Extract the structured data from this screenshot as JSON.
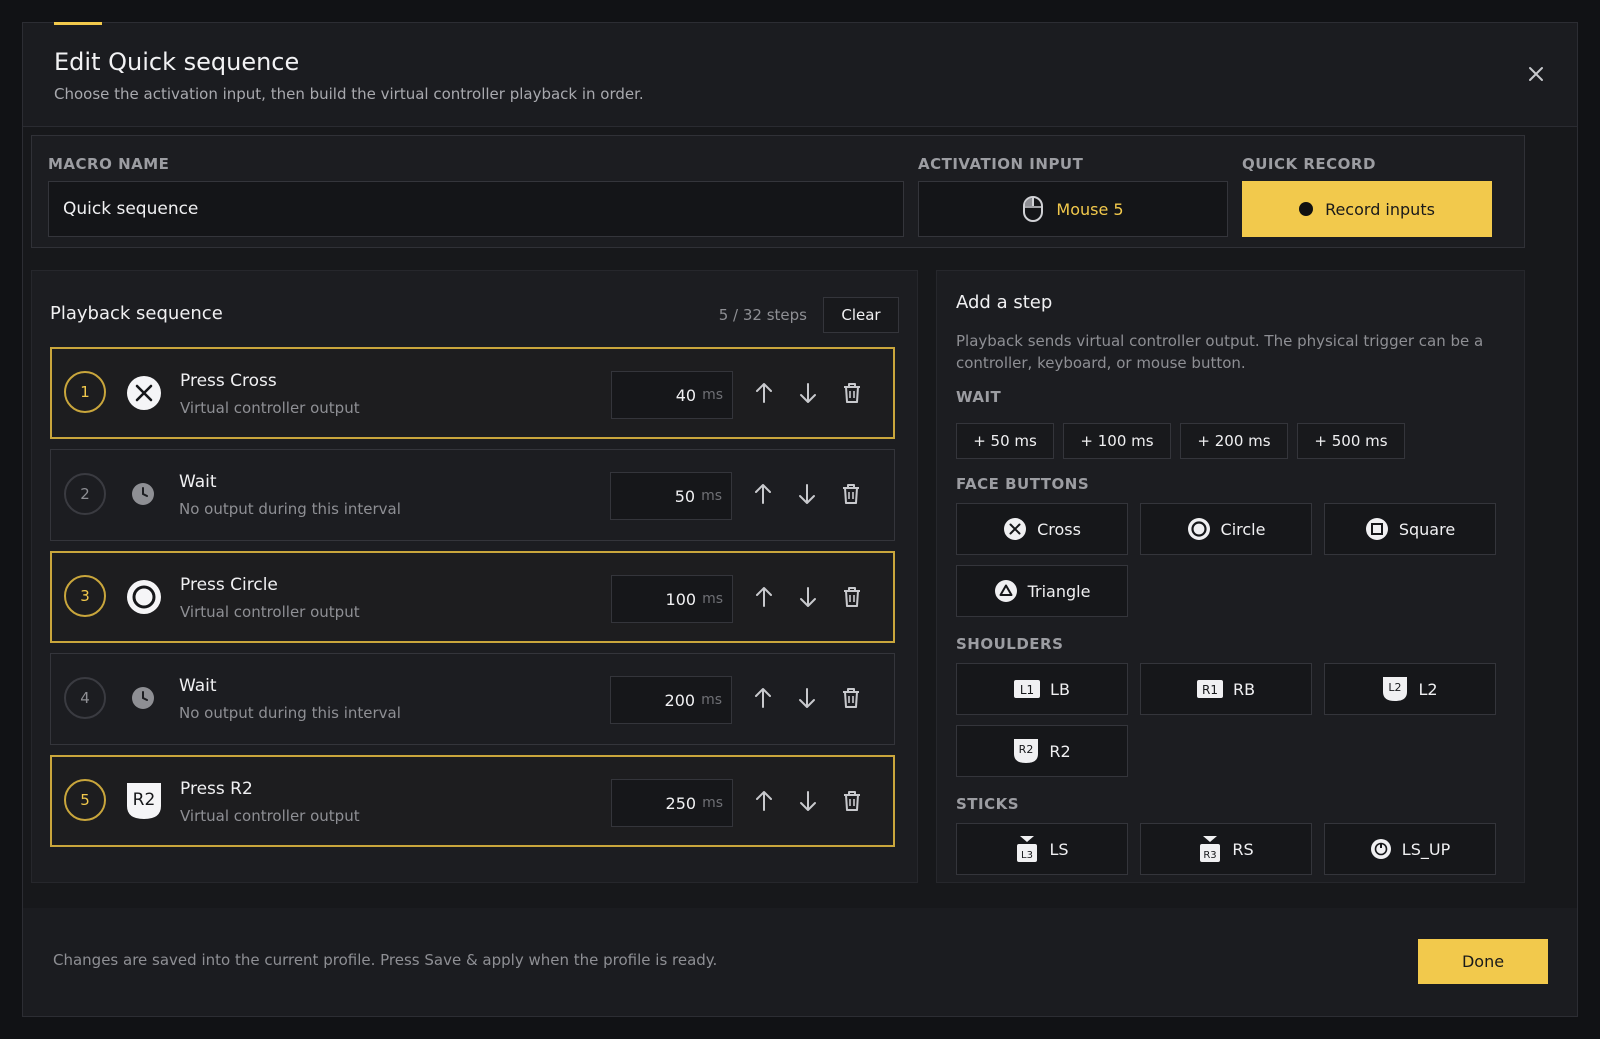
{
  "header": {
    "title": "Edit Quick sequence",
    "subtitle": "Choose the activation input, then build the virtual controller playback in order."
  },
  "top": {
    "macro_name_label": "MACRO NAME",
    "macro_name_value": "Quick sequence",
    "activation_label": "ACTIVATION INPUT",
    "activation_value": "Mouse 5",
    "quick_record_label": "QUICK RECORD",
    "record_button": "Record inputs"
  },
  "sequence": {
    "title": "Playback sequence",
    "count": "5 / 32 steps",
    "clear_label": "Clear",
    "ms_unit": "ms",
    "steps": [
      {
        "num": "1",
        "icon": "cross-icon",
        "title": "Press Cross",
        "sub": "Virtual controller output",
        "ms": "40",
        "active": true
      },
      {
        "num": "2",
        "icon": "clock-icon",
        "title": "Wait",
        "sub": "No output during this interval",
        "ms": "50",
        "active": false
      },
      {
        "num": "3",
        "icon": "circle-icon",
        "title": "Press Circle",
        "sub": "Virtual controller output",
        "ms": "100",
        "active": true
      },
      {
        "num": "4",
        "icon": "clock-icon",
        "title": "Wait",
        "sub": "No output during this interval",
        "ms": "200",
        "active": false
      },
      {
        "num": "5",
        "icon": "r2-icon",
        "title": "Press R2",
        "sub": "Virtual controller output",
        "ms": "250",
        "active": true
      }
    ]
  },
  "add_step": {
    "title": "Add a step",
    "description": "Playback sends virtual controller output. The physical trigger can be a controller, keyboard, or mouse button.",
    "wait_label": "WAIT",
    "wait_buttons": [
      "+ 50 ms",
      "+ 100 ms",
      "+ 200 ms",
      "+ 500 ms"
    ],
    "face_label": "FACE BUTTONS",
    "face_buttons": [
      "Cross",
      "Circle",
      "Square",
      "Triangle"
    ],
    "shoulders_label": "SHOULDERS",
    "shoulder_buttons": [
      "LB",
      "RB",
      "L2",
      "R2"
    ],
    "shoulder_glyphs": [
      "L1",
      "R1",
      "L2",
      "R2"
    ],
    "sticks_label": "STICKS",
    "stick_buttons": [
      "LS",
      "RS",
      "LS_UP"
    ],
    "stick_glyphs": [
      "L3",
      "R3"
    ]
  },
  "footer": {
    "note": "Changes are saved into the current profile. Press Save & apply when the profile is ready.",
    "done_label": "Done"
  },
  "colors": {
    "accent": "#f2c94c",
    "background": "#111215",
    "panel": "#1c1d21"
  }
}
